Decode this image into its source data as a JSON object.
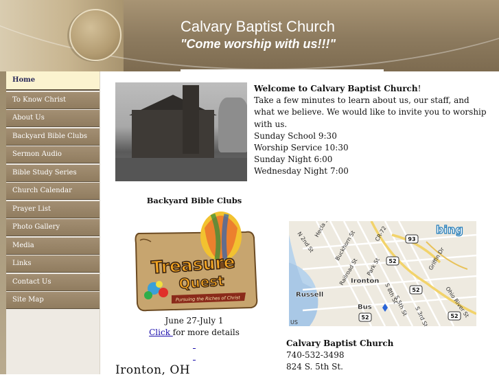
{
  "header": {
    "title": "Calvary Baptist Church",
    "tagline": "\"Come worship with us!!!\""
  },
  "nav": {
    "items": [
      {
        "label": "Home"
      },
      {
        "label": "To Know Christ"
      },
      {
        "label": "About Us"
      },
      {
        "label": "Backyard Bible Clubs"
      },
      {
        "label": "Sermon Audio"
      },
      {
        "label": "Bible Study Series"
      },
      {
        "label": "Church Calendar"
      },
      {
        "label": "Prayer List"
      },
      {
        "label": "Photo Gallery"
      },
      {
        "label": "Media"
      },
      {
        "label": "Links"
      },
      {
        "label": "Contact Us"
      },
      {
        "label": "Site Map"
      }
    ],
    "active_index": 0
  },
  "welcome": {
    "title": "Welcome to Calvary Baptist Church",
    "intro": "Take a few minutes to learn about us, our staff, and what we believe. We would like to invite you to worship with us.",
    "schedule": [
      "Sunday School 9:30",
      "Worship Service 10:30",
      "Sunday Night 6:00",
      "Wednesday Night 7:00"
    ]
  },
  "backyard_bible_clubs": {
    "heading": "Backyard Bible Clubs",
    "image_title_line1": "Treasure",
    "image_title_line2": "Quest",
    "image_subtitle": "Pursuing the Riches of Christ",
    "dates": "June 27-July 1",
    "link_label": "Click ",
    "link_suffix": "for more details"
  },
  "city_heading": "Ironton, OH",
  "map": {
    "provider": "bing",
    "labels": {
      "ironton": "Ironton",
      "russell": "Russell",
      "bus": "Bus",
      "route_93": "93",
      "route_52a": "52",
      "route_52b": "52",
      "route_52c": "52",
      "route_52d": "52",
      "n_2nd": "N 2nd St",
      "hecla": "Hecla St",
      "buckhorn": "Buckhorn St",
      "railroad": "Railroad St",
      "park": "Park St",
      "cr72": "CR-72",
      "griffin": "Griffin Dr",
      "s8th": "S 8th St",
      "s5th": "S 5th St",
      "ohio_river": "Ohio River St",
      "s3rd": "S 3rd St",
      "us": "US"
    }
  },
  "address": {
    "name": "Calvary Baptist Church",
    "phone": "740-532-3498",
    "street": "824 S. 5th St."
  }
}
